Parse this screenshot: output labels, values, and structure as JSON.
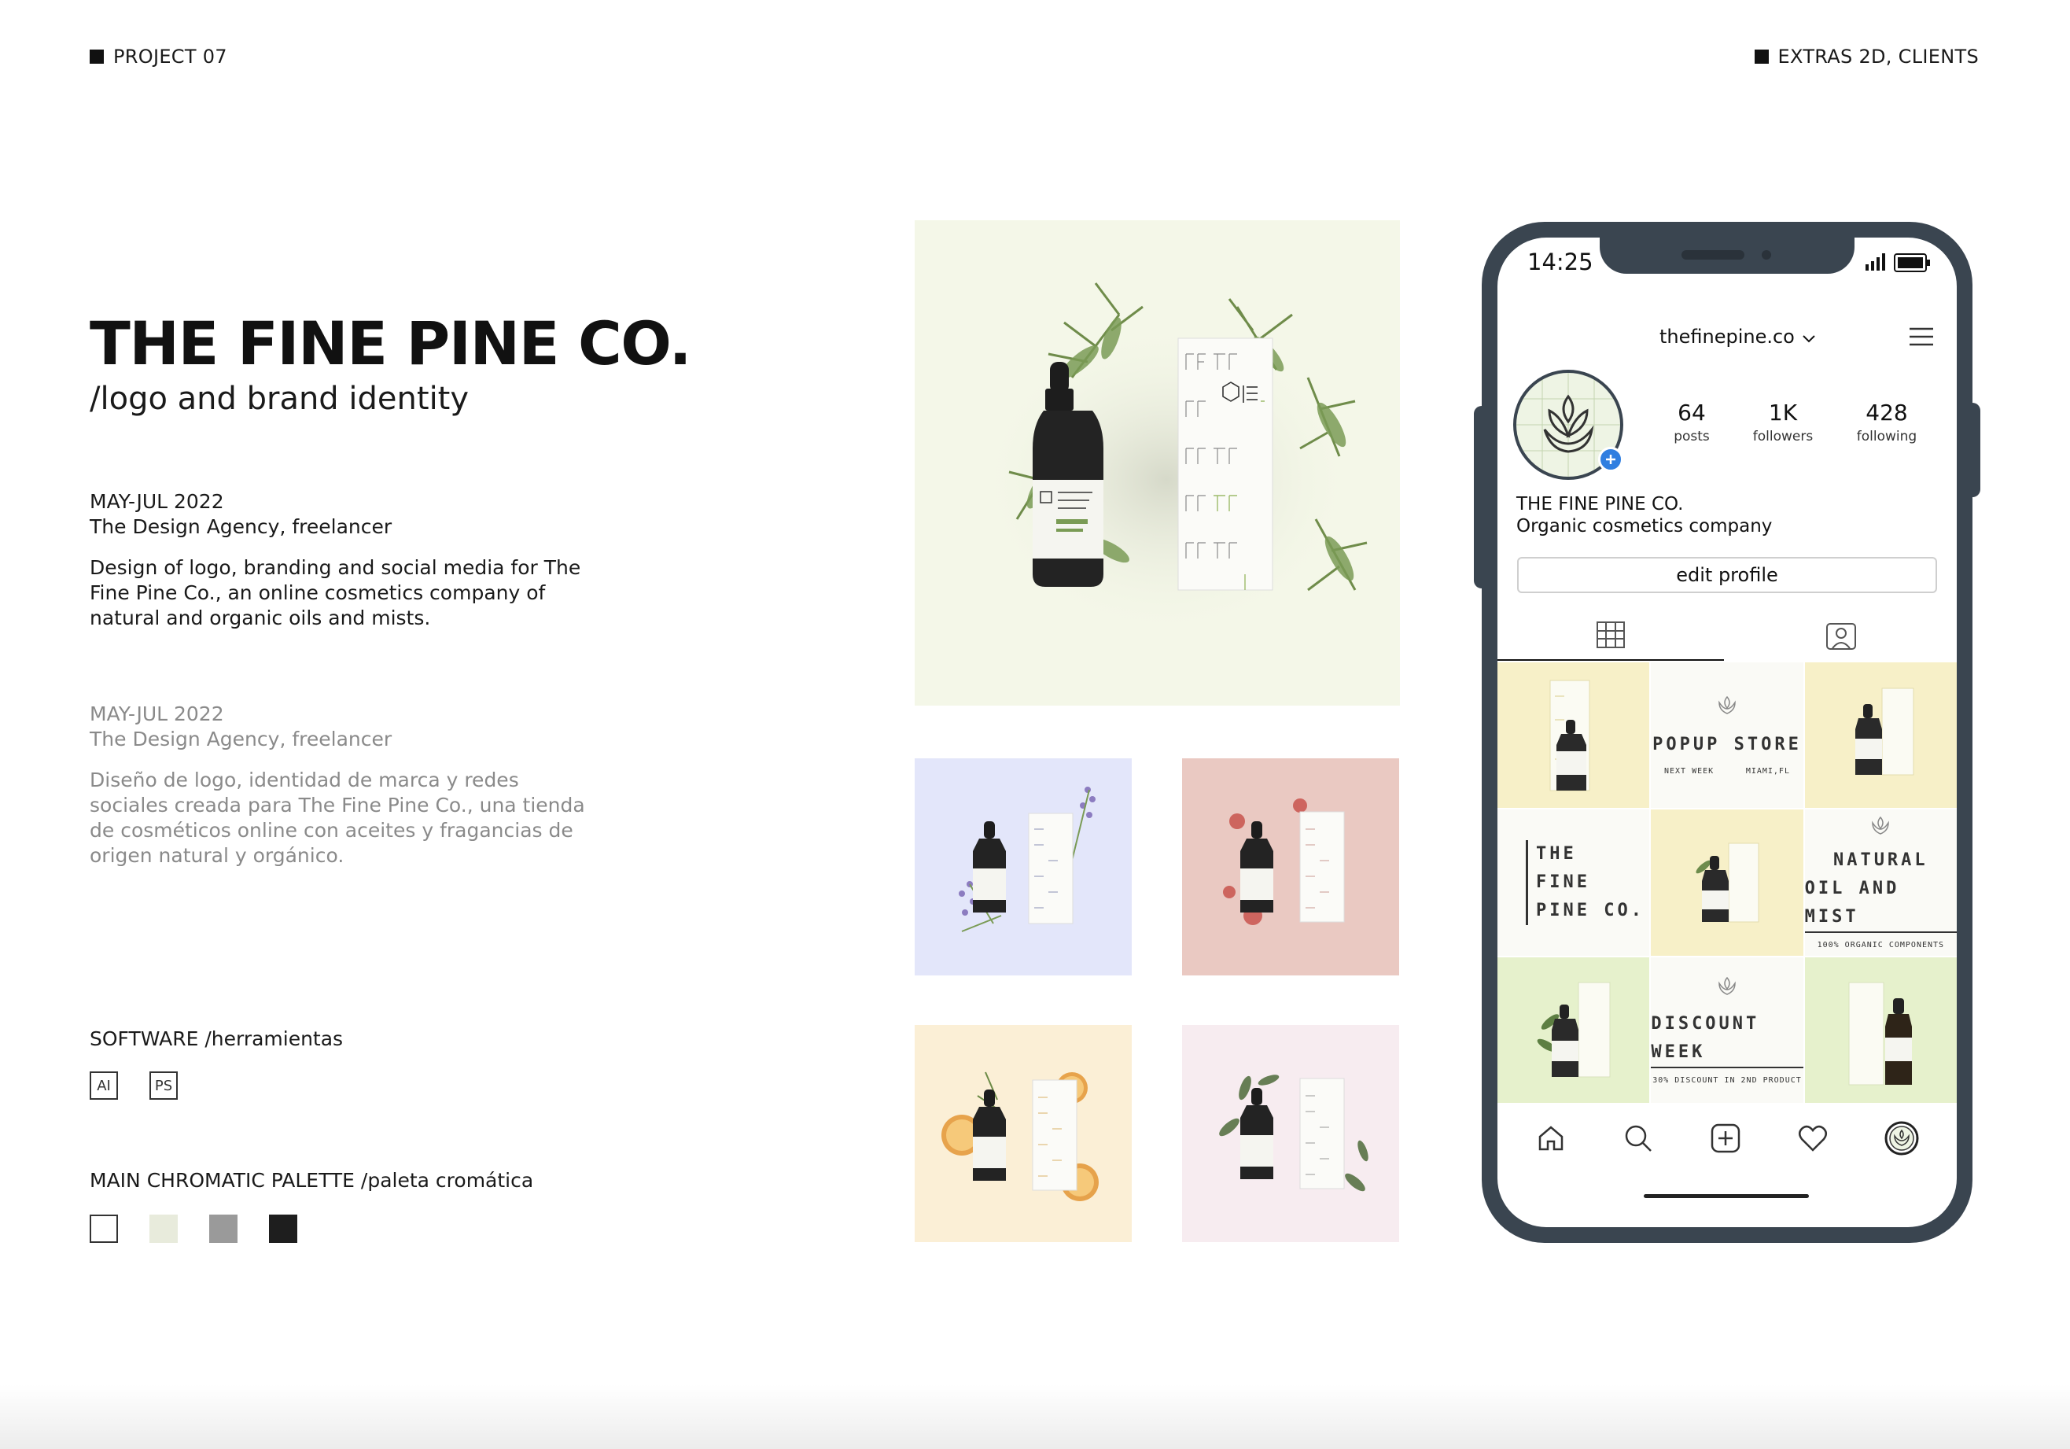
{
  "header": {
    "left_label": "PROJECT 07",
    "right_label": "EXTRAS 2D, CLIENTS"
  },
  "project": {
    "title": "THE FINE PINE CO.",
    "subtitle": "/logo and brand identity"
  },
  "english": {
    "dates": "MAY-JUL 2022",
    "role": "The Design Agency, freelancer",
    "description": "Design of logo, branding and social media for The Fine Pine Co., an online cosmetics company of natural and organic oils and mists."
  },
  "spanish": {
    "dates": "MAY-JUL 2022",
    "role": "The Design Agency, freelancer",
    "description": "Diseño de logo, identidad de marca y redes sociales creada para The Fine Pine Co., una tienda de cosméticos online con aceites y fragancias de origen natural y orgánico."
  },
  "software": {
    "label": "SOFTWARE /herramientas",
    "items": [
      "AI",
      "PS"
    ]
  },
  "palette": {
    "label": "MAIN CHROMATIC PALETTE /paleta cromática",
    "colors": [
      "#ffffff",
      "#e8ebdc",
      "#9a9a9a",
      "#1e1e1e"
    ]
  },
  "phone": {
    "time": "14:25",
    "handle": "thefinepine.co",
    "stats": [
      {
        "value": "64",
        "label": "posts"
      },
      {
        "value": "1K",
        "label": "followers"
      },
      {
        "value": "428",
        "label": "following"
      }
    ],
    "bio_name": "THE FINE PINE CO.",
    "bio_desc": "Organic cosmetics company",
    "edit_button": "edit profile",
    "posts": {
      "popup_title": "POPUP STORE",
      "popup_left": "NEXT WEEK",
      "popup_right": "MIAMI,FL",
      "brand_lines": [
        "THE",
        "FINE",
        "PINE CO."
      ],
      "natural_line1": "NATURAL",
      "natural_line2": "OIL AND MIST",
      "natural_sub": "100% ORGANIC COMPONENTS",
      "discount_title": "DISCOUNT WEEK",
      "discount_sub": "30% DISCOUNT IN 2ND PRODUCT"
    }
  }
}
